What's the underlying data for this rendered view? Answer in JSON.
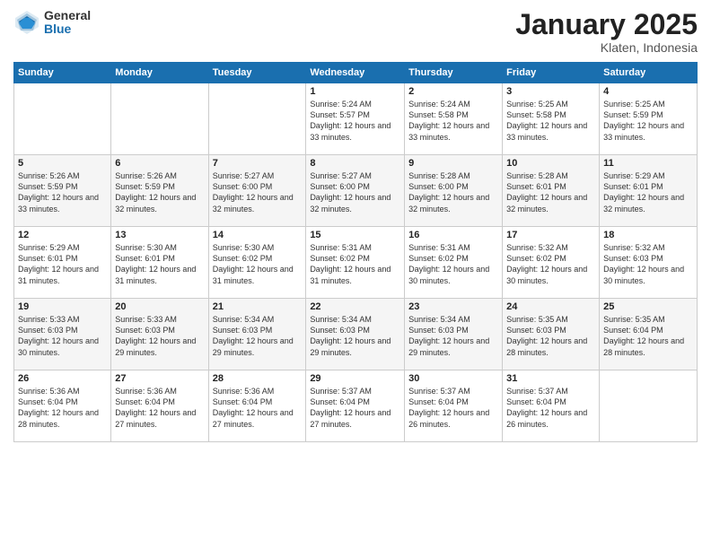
{
  "header": {
    "logo_general": "General",
    "logo_blue": "Blue",
    "title": "January 2025",
    "location": "Klaten, Indonesia"
  },
  "weekdays": [
    "Sunday",
    "Monday",
    "Tuesday",
    "Wednesday",
    "Thursday",
    "Friday",
    "Saturday"
  ],
  "weeks": [
    [
      {
        "day": "",
        "sunrise": "",
        "sunset": "",
        "daylight": ""
      },
      {
        "day": "",
        "sunrise": "",
        "sunset": "",
        "daylight": ""
      },
      {
        "day": "",
        "sunrise": "",
        "sunset": "",
        "daylight": ""
      },
      {
        "day": "1",
        "sunrise": "Sunrise: 5:24 AM",
        "sunset": "Sunset: 5:57 PM",
        "daylight": "Daylight: 12 hours and 33 minutes."
      },
      {
        "day": "2",
        "sunrise": "Sunrise: 5:24 AM",
        "sunset": "Sunset: 5:58 PM",
        "daylight": "Daylight: 12 hours and 33 minutes."
      },
      {
        "day": "3",
        "sunrise": "Sunrise: 5:25 AM",
        "sunset": "Sunset: 5:58 PM",
        "daylight": "Daylight: 12 hours and 33 minutes."
      },
      {
        "day": "4",
        "sunrise": "Sunrise: 5:25 AM",
        "sunset": "Sunset: 5:59 PM",
        "daylight": "Daylight: 12 hours and 33 minutes."
      }
    ],
    [
      {
        "day": "5",
        "sunrise": "Sunrise: 5:26 AM",
        "sunset": "Sunset: 5:59 PM",
        "daylight": "Daylight: 12 hours and 33 minutes."
      },
      {
        "day": "6",
        "sunrise": "Sunrise: 5:26 AM",
        "sunset": "Sunset: 5:59 PM",
        "daylight": "Daylight: 12 hours and 32 minutes."
      },
      {
        "day": "7",
        "sunrise": "Sunrise: 5:27 AM",
        "sunset": "Sunset: 6:00 PM",
        "daylight": "Daylight: 12 hours and 32 minutes."
      },
      {
        "day": "8",
        "sunrise": "Sunrise: 5:27 AM",
        "sunset": "Sunset: 6:00 PM",
        "daylight": "Daylight: 12 hours and 32 minutes."
      },
      {
        "day": "9",
        "sunrise": "Sunrise: 5:28 AM",
        "sunset": "Sunset: 6:00 PM",
        "daylight": "Daylight: 12 hours and 32 minutes."
      },
      {
        "day": "10",
        "sunrise": "Sunrise: 5:28 AM",
        "sunset": "Sunset: 6:01 PM",
        "daylight": "Daylight: 12 hours and 32 minutes."
      },
      {
        "day": "11",
        "sunrise": "Sunrise: 5:29 AM",
        "sunset": "Sunset: 6:01 PM",
        "daylight": "Daylight: 12 hours and 32 minutes."
      }
    ],
    [
      {
        "day": "12",
        "sunrise": "Sunrise: 5:29 AM",
        "sunset": "Sunset: 6:01 PM",
        "daylight": "Daylight: 12 hours and 31 minutes."
      },
      {
        "day": "13",
        "sunrise": "Sunrise: 5:30 AM",
        "sunset": "Sunset: 6:01 PM",
        "daylight": "Daylight: 12 hours and 31 minutes."
      },
      {
        "day": "14",
        "sunrise": "Sunrise: 5:30 AM",
        "sunset": "Sunset: 6:02 PM",
        "daylight": "Daylight: 12 hours and 31 minutes."
      },
      {
        "day": "15",
        "sunrise": "Sunrise: 5:31 AM",
        "sunset": "Sunset: 6:02 PM",
        "daylight": "Daylight: 12 hours and 31 minutes."
      },
      {
        "day": "16",
        "sunrise": "Sunrise: 5:31 AM",
        "sunset": "Sunset: 6:02 PM",
        "daylight": "Daylight: 12 hours and 30 minutes."
      },
      {
        "day": "17",
        "sunrise": "Sunrise: 5:32 AM",
        "sunset": "Sunset: 6:02 PM",
        "daylight": "Daylight: 12 hours and 30 minutes."
      },
      {
        "day": "18",
        "sunrise": "Sunrise: 5:32 AM",
        "sunset": "Sunset: 6:03 PM",
        "daylight": "Daylight: 12 hours and 30 minutes."
      }
    ],
    [
      {
        "day": "19",
        "sunrise": "Sunrise: 5:33 AM",
        "sunset": "Sunset: 6:03 PM",
        "daylight": "Daylight: 12 hours and 30 minutes."
      },
      {
        "day": "20",
        "sunrise": "Sunrise: 5:33 AM",
        "sunset": "Sunset: 6:03 PM",
        "daylight": "Daylight: 12 hours and 29 minutes."
      },
      {
        "day": "21",
        "sunrise": "Sunrise: 5:34 AM",
        "sunset": "Sunset: 6:03 PM",
        "daylight": "Daylight: 12 hours and 29 minutes."
      },
      {
        "day": "22",
        "sunrise": "Sunrise: 5:34 AM",
        "sunset": "Sunset: 6:03 PM",
        "daylight": "Daylight: 12 hours and 29 minutes."
      },
      {
        "day": "23",
        "sunrise": "Sunrise: 5:34 AM",
        "sunset": "Sunset: 6:03 PM",
        "daylight": "Daylight: 12 hours and 29 minutes."
      },
      {
        "day": "24",
        "sunrise": "Sunrise: 5:35 AM",
        "sunset": "Sunset: 6:03 PM",
        "daylight": "Daylight: 12 hours and 28 minutes."
      },
      {
        "day": "25",
        "sunrise": "Sunrise: 5:35 AM",
        "sunset": "Sunset: 6:04 PM",
        "daylight": "Daylight: 12 hours and 28 minutes."
      }
    ],
    [
      {
        "day": "26",
        "sunrise": "Sunrise: 5:36 AM",
        "sunset": "Sunset: 6:04 PM",
        "daylight": "Daylight: 12 hours and 28 minutes."
      },
      {
        "day": "27",
        "sunrise": "Sunrise: 5:36 AM",
        "sunset": "Sunset: 6:04 PM",
        "daylight": "Daylight: 12 hours and 27 minutes."
      },
      {
        "day": "28",
        "sunrise": "Sunrise: 5:36 AM",
        "sunset": "Sunset: 6:04 PM",
        "daylight": "Daylight: 12 hours and 27 minutes."
      },
      {
        "day": "29",
        "sunrise": "Sunrise: 5:37 AM",
        "sunset": "Sunset: 6:04 PM",
        "daylight": "Daylight: 12 hours and 27 minutes."
      },
      {
        "day": "30",
        "sunrise": "Sunrise: 5:37 AM",
        "sunset": "Sunset: 6:04 PM",
        "daylight": "Daylight: 12 hours and 26 minutes."
      },
      {
        "day": "31",
        "sunrise": "Sunrise: 5:37 AM",
        "sunset": "Sunset: 6:04 PM",
        "daylight": "Daylight: 12 hours and 26 minutes."
      },
      {
        "day": "",
        "sunrise": "",
        "sunset": "",
        "daylight": ""
      }
    ]
  ]
}
